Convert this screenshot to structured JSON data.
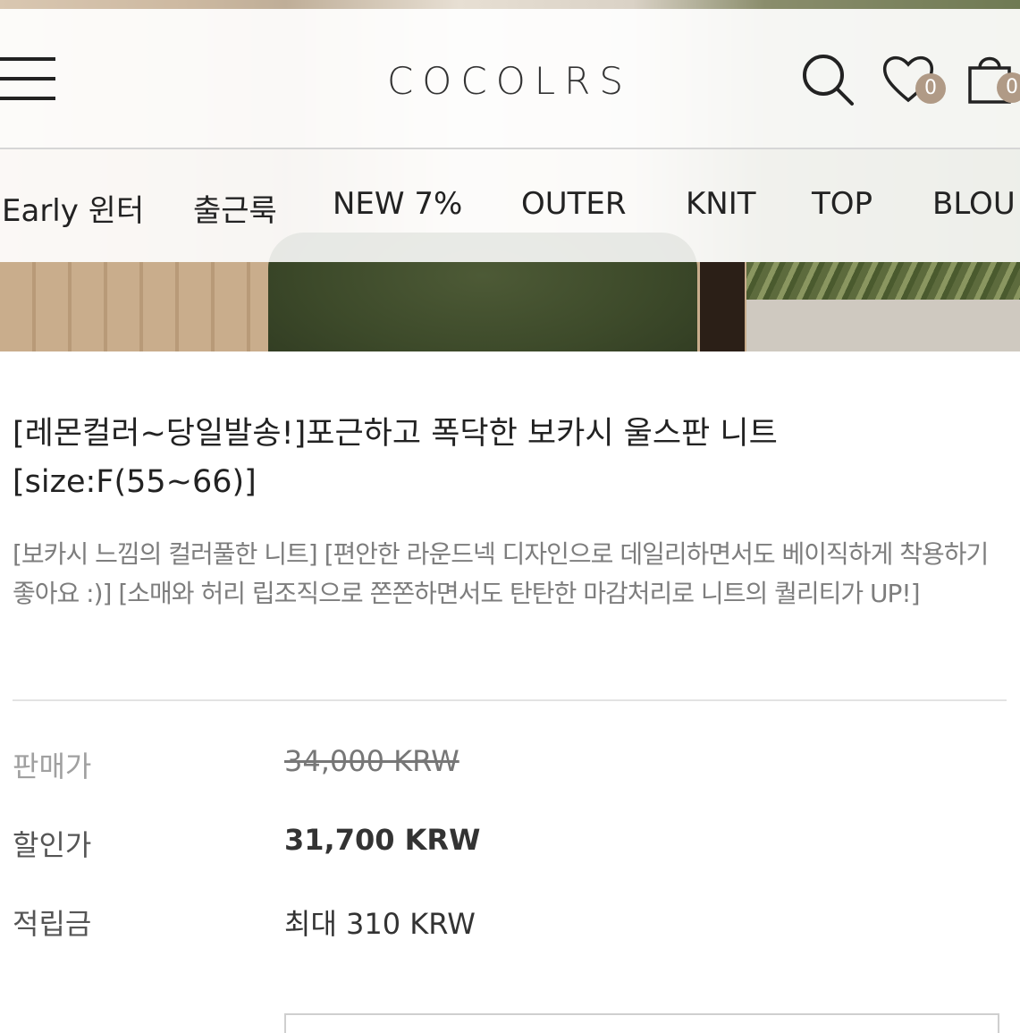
{
  "header": {
    "logo": "COCOLRS",
    "wishlist_count": "0",
    "cart_count": "0"
  },
  "categories": [
    "Early 윈터",
    "출근룩",
    "NEW 7%",
    "OUTER",
    "KNIT",
    "TOP",
    "BLOU"
  ],
  "product": {
    "title": "[레몬컬러~당일발송!]포근하고 폭닥한 보카시 울스판 니트[size:F(55~66)]",
    "description": "[보카시 느낌의 컬러풀한 니트] [편안한 라운드넥 디자인으로 데일리하면서도 베이직하게 착용하기 좋아요 :)] [소매와 허리 립조직으로 쫀쫀하면서도 탄탄한 마감처리로 니트의 퀄리티가 UP!]"
  },
  "pricing": {
    "sale_label": "판매가",
    "sale_value": "34,000 KRW",
    "discount_label": "할인가",
    "discount_value": "31,700 KRW",
    "points_label": "적립금",
    "points_value": "최대 310 KRW"
  },
  "icons": {
    "menu": "hamburger-menu-icon",
    "search": "search-icon",
    "wishlist": "heart-icon",
    "cart": "shopping-bag-icon"
  },
  "colors": {
    "badge": "#b09a86",
    "text": "#222222",
    "muted": "#7d7d7d"
  }
}
